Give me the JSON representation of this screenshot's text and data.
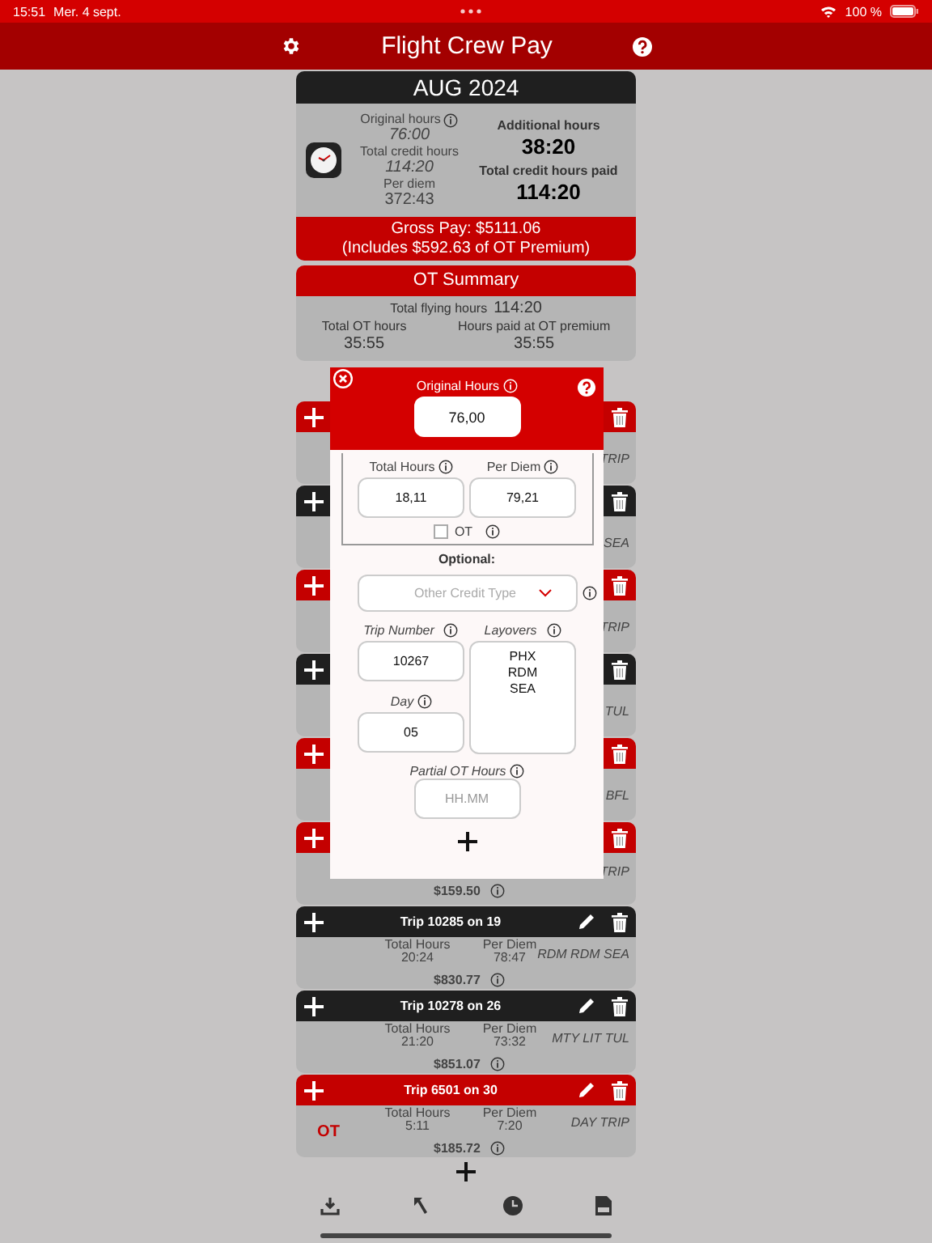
{
  "status_bar": {
    "time": "15:51",
    "date": "Mer. 4 sept.",
    "battery": "100 %"
  },
  "nav": {
    "title": "Flight Crew Pay"
  },
  "summary": {
    "month": "AUG 2024",
    "original_label": "Original hours",
    "original": "76:00",
    "credit_label": "Total credit hours",
    "credit": "114:20",
    "per_diem_label": "Per diem",
    "per_diem": "372:43",
    "additional_label": "Additional hours",
    "additional": "38:20",
    "paid_label": "Total credit hours paid",
    "paid": "114:20",
    "gross_pay": "Gross Pay: $5111.06",
    "ot_note": "(Includes $592.63 of OT Premium)"
  },
  "ot_summary": {
    "title": "OT Summary",
    "flying_label": "Total flying hours",
    "flying": "114:20",
    "ot_label": "Total OT hours",
    "ot": "35:55",
    "premium_label": "Hours paid at OT premium",
    "premium": "35:55"
  },
  "trips": [
    {
      "ot": true,
      "route": "TRIP"
    },
    {
      "ot": false,
      "route": "SEA"
    },
    {
      "ot": true,
      "route": "TRIP"
    },
    {
      "ot": false,
      "route": "TUL"
    },
    {
      "ot": true,
      "route": "BFL"
    },
    {
      "ot": true,
      "pay": "$159.50",
      "route": "TRIP"
    },
    {
      "ot": false,
      "title": "Trip 10285 on 19",
      "total_label": "Total Hours",
      "total": "20:24",
      "per_diem_label": "Per Diem",
      "per_diem": "78:47",
      "pay": "$830.77",
      "route": "RDM RDM SEA"
    },
    {
      "ot": false,
      "title": "Trip 10278 on 26",
      "total_label": "Total Hours",
      "total": "21:20",
      "per_diem_label": "Per Diem",
      "per_diem": "73:32",
      "pay": "$851.07",
      "route": "MTY LIT TUL"
    },
    {
      "ot": true,
      "title": "Trip 6501 on 30",
      "badge": "OT",
      "total_label": "Total Hours",
      "total": "5:11",
      "per_diem_label": "Per Diem",
      "per_diem": "7:20",
      "pay": "$185.72",
      "route": "DAY TRIP"
    }
  ],
  "dialog": {
    "original_label": "Original Hours",
    "original": "76,00",
    "total_label": "Total Hours",
    "total": "18,11",
    "per_diem_label": "Per Diem",
    "per_diem": "79,21",
    "ot_label": "OT",
    "ot_checked": false,
    "optional_label": "Optional:",
    "credit_type_placeholder": "Other Credit Type",
    "trip_label": "Trip Number",
    "trip": "10267",
    "layovers_label": "Layovers",
    "layovers": "PHX\nRDM\nSEA",
    "day_label": "Day",
    "day": "05",
    "partial_label": "Partial OT Hours",
    "partial_placeholder": "HH.MM"
  }
}
